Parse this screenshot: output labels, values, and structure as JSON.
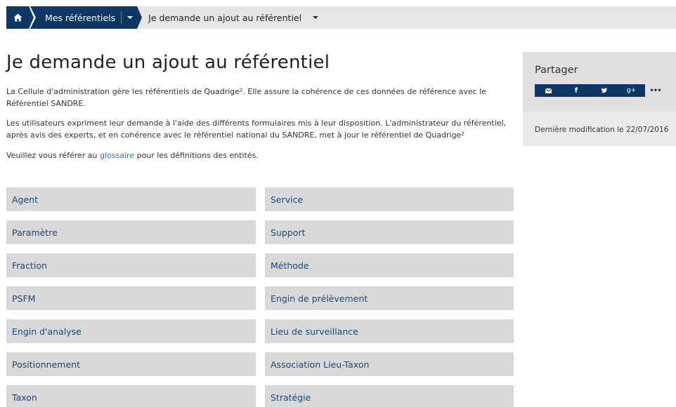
{
  "breadcrumb": {
    "home_icon": "home-icon",
    "section": "Mes référentiels",
    "current": "Je demande un ajout au référentiel"
  },
  "page": {
    "title": "Je demande un ajout au référentiel",
    "paragraph1": "La Cellule d'administration gère les référentiels de Quadrige². Elle assure la cohérence de ces données de référence avec le Référentiel SANDRE.",
    "paragraph2": "Les utilisateurs expriment leur demande à l'aide des différents formulaires mis à leur disposition. L'administrateur du référentiel, après avis des experts, et en cohérence avec le référentiel national du SANDRE, met à jour le référentiel de Quadrige²",
    "paragraph3_before": "Veuillez vous référer au ",
    "paragraph3_link": "glossaire",
    "paragraph3_after": " pour les définitions des entités."
  },
  "cards": [
    "Agent",
    "Service",
    "Paramètre",
    "Support",
    "Fraction",
    "Méthode",
    "PSFM",
    "Engin de prélèvement",
    "Engin d'analyse",
    "Lieu de surveillance",
    "Positionnement",
    "Association Lieu-Taxon",
    "Taxon",
    "Stratégie"
  ],
  "sidebar": {
    "title": "Partager",
    "share_icons": [
      "envelope-icon",
      "facebook-icon",
      "twitter-icon",
      "google-plus-icon",
      "more-icon"
    ],
    "last_modified": "Dernière modification le 22/07/2016"
  },
  "colors": {
    "navy": "#0f3766",
    "card_bg": "#d9d9d9",
    "card_text": "#1d4677",
    "link": "#2b74b8"
  }
}
